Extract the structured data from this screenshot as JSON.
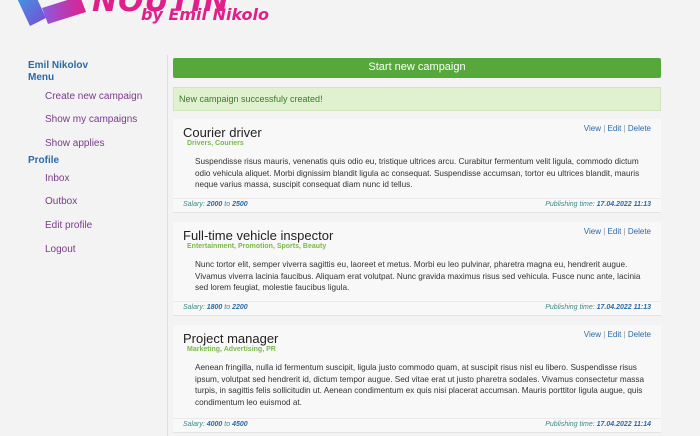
{
  "logo": {
    "title": "NOUTIN",
    "subtitle": "by Emil Nikolov"
  },
  "sidebar": {
    "user_name": "Emil Nikolov",
    "menu_heading": "Menu",
    "menu_items": [
      {
        "label": "Create new campaign"
      },
      {
        "label": "Show my campaigns"
      },
      {
        "label": "Show applies"
      }
    ],
    "profile_heading": "Profile",
    "profile_items": [
      {
        "label": "Inbox"
      },
      {
        "label": "Outbox"
      },
      {
        "label": "Edit profile"
      },
      {
        "label": "Logout"
      }
    ]
  },
  "main": {
    "start_button": "Start new campaign",
    "alert": "New campaign successfuly created!",
    "actions": {
      "view": "View",
      "edit": "Edit",
      "delete": "Delete",
      "separator": "|"
    },
    "salary_label": "Salary:",
    "to_label": "to",
    "pub_label": "Publishing time:",
    "campaigns": [
      {
        "title": "Courier driver",
        "tags": "Drivers, Couriers",
        "description": "Suspendisse risus mauris, venenatis quis odio eu, tristique ultrices arcu. Curabitur fermentum velit ligula, commodo dictum odio vehicula aliquet. Morbi dignissim blandit ligula ac consequat. Suspendisse accumsan, tortor eu ultrices blandit, mauris neque varius massa, suscipit consequat diam nunc id tellus.",
        "salary_from": "2000",
        "salary_to": "2500",
        "published": "17.04.2022 11:13"
      },
      {
        "title": "Full-time vehicle inspector",
        "tags": "Entertainment, Promotion, Sports, Beauty",
        "description": "Nunc tortor elit, semper viverra sagittis eu, laoreet et metus. Morbi eu leo pulvinar, pharetra magna eu, hendrerit augue. Vivamus viverra lacinia faucibus. Aliquam erat volutpat. Nunc gravida maximus risus sed vehicula. Fusce nunc ante, lacinia sed lorem feugiat, molestie faucibus ligula.",
        "salary_from": "1800",
        "salary_to": "2200",
        "published": "17.04.2022 11:13"
      },
      {
        "title": "Project manager",
        "tags": "Marketing, Advertising, PR",
        "description": "Aenean fringilla, nulla id fermentum suscipit, ligula justo commodo quam, at suscipit risus nisl eu libero. Suspendisse risus ipsum, volutpat sed hendrerit id, dictum tempor augue. Sed vitae erat ut justo pharetra sodales. Vivamus consectetur massa turpis, in sagittis felis sollicitudin ut. Aenean condimentum ex quis nisi placerat accumsan. Mauris porttitor ligula augue, quis condimentum leo euismod at.",
        "salary_from": "4000",
        "salary_to": "4500",
        "published": "17.04.2022 11:14"
      }
    ]
  },
  "colors": {
    "accent_green": "#56a83a",
    "alert_bg": "#e0f1cf",
    "logo_pink": "#e0208a",
    "link_blue": "#2a6aa8",
    "link_purple": "#7a3a8a"
  }
}
